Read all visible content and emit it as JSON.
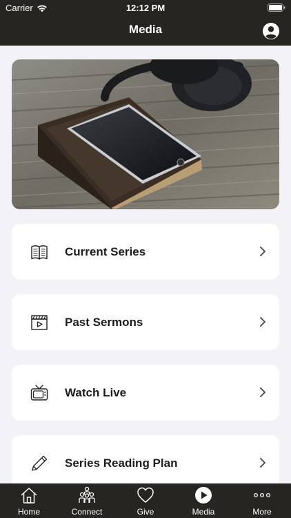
{
  "status_bar": {
    "carrier": "Carrier",
    "time": "12:12 PM"
  },
  "header": {
    "title": "Media"
  },
  "cards": [
    {
      "label": "Current Series",
      "icon": "book-icon"
    },
    {
      "label": "Past Sermons",
      "icon": "video-clapper-icon"
    },
    {
      "label": "Watch Live",
      "icon": "tv-icon"
    },
    {
      "label": "Series Reading Plan",
      "icon": "pencil-icon"
    }
  ],
  "tabbar": {
    "items": [
      {
        "label": "Home",
        "icon": "home-icon"
      },
      {
        "label": "Connect",
        "icon": "people-icon"
      },
      {
        "label": "Give",
        "icon": "heart-icon"
      },
      {
        "label": "Media",
        "icon": "play-circle-icon",
        "active": true
      },
      {
        "label": "More",
        "icon": "more-dots-icon"
      }
    ]
  },
  "colors": {
    "bar_background": "#262522",
    "page_background": "#f2f2f7",
    "card_background": "#ffffff"
  }
}
